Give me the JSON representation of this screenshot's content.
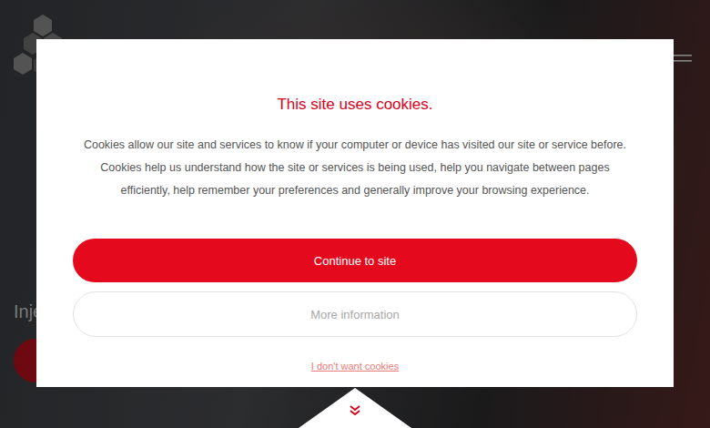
{
  "hero": {
    "heading": "Inje"
  },
  "cookie_dialog": {
    "title": "This site uses cookies.",
    "body": "Cookies allow our site and services to know if your computer or device has visited our site or service before. Cookies help us understand how the site or services is being used, help you navigate between pages efficiently, help remember your preferences and generally improve your browsing experience.",
    "buttons": [
      {
        "label": "Continue to site",
        "kind": "primary"
      },
      {
        "label": "More information",
        "kind": "secondary"
      }
    ],
    "decline_link": "I don't want cookies"
  }
}
